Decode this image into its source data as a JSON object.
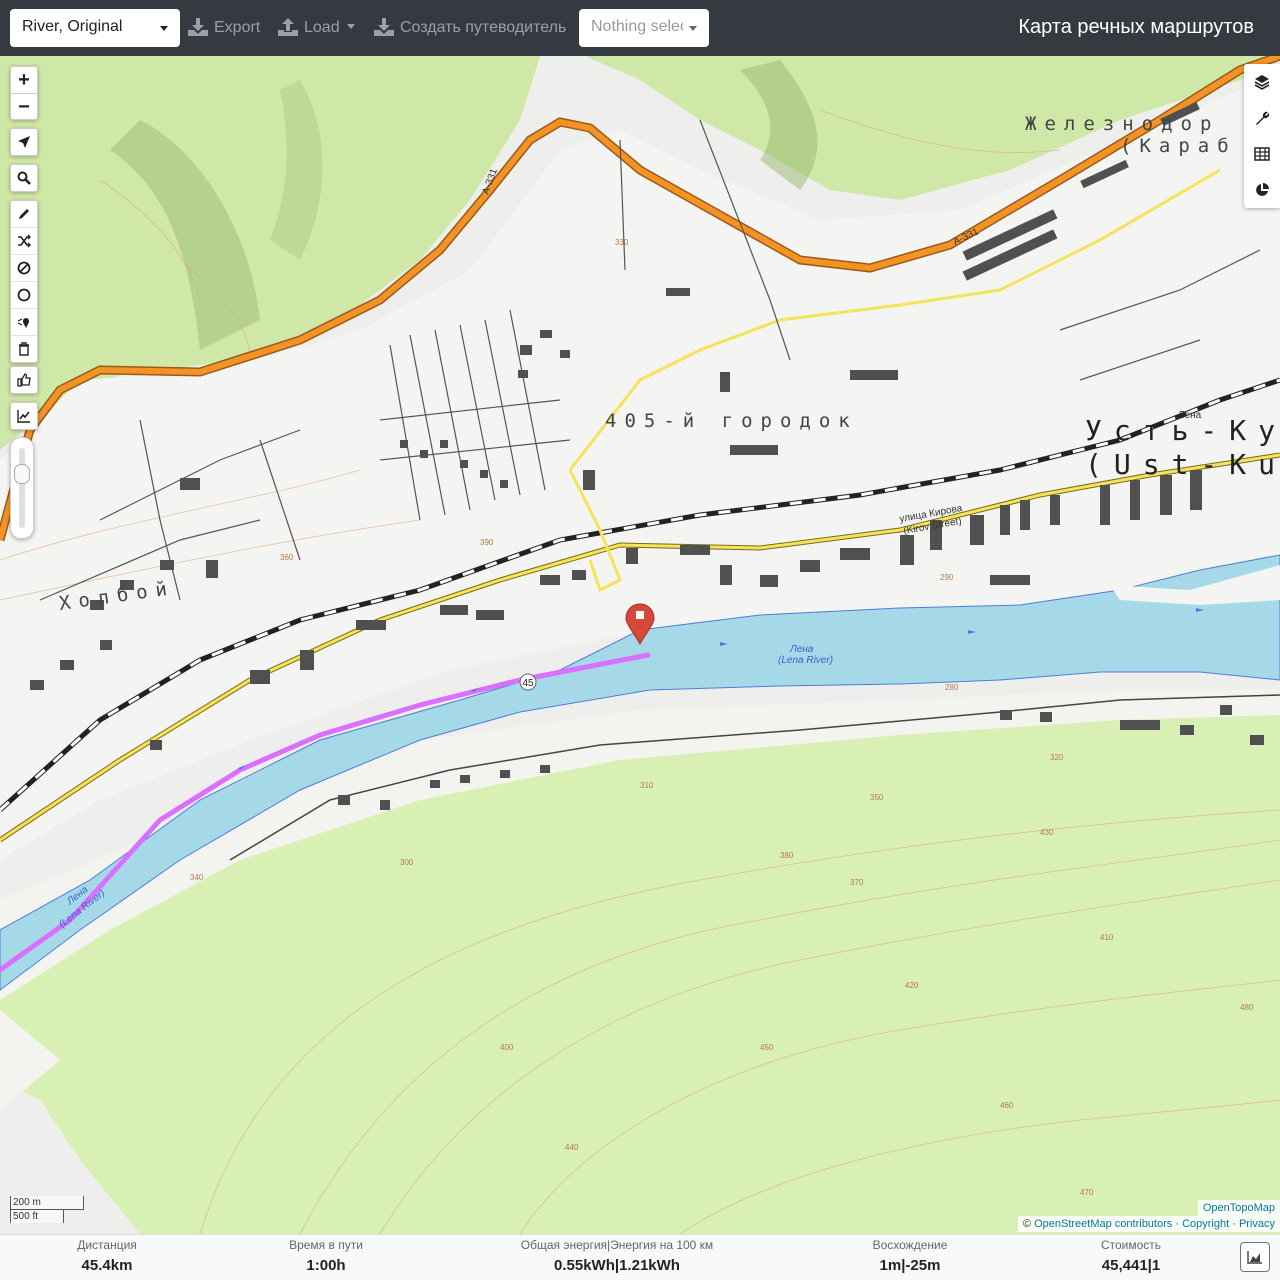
{
  "header": {
    "profile_select": "River, Original",
    "export_label": "Export",
    "load_label": "Load",
    "guide_label": "Создать путеводитель",
    "nothing_selected": "Nothing selected",
    "app_title": "Карта речных маршрутов"
  },
  "map": {
    "labels": {
      "settlement_405": "405-й городок",
      "ust_kut": "Усть-Ку",
      "ust_kut_latin": "(Ust-Ku",
      "zheleznodor": "Железнодор",
      "karab": "(Караб",
      "holboy": "Холбой",
      "lena_river_1": "Лена",
      "lena_river_1_latin": "(Lena River)",
      "lena_river_2": "Лена",
      "lena_river_2_latin": "(Lena River)",
      "kirova_street": "улица Кирова",
      "kirova_street_latin": "(Kirov Street)",
      "road_a331_1": "А-331",
      "road_a331_2": "А-331",
      "lena_small": "Лена",
      "km_marker": "45"
    },
    "contour_labels": [
      "360",
      "380",
      "390",
      "410",
      "420",
      "440",
      "470",
      "280",
      "290",
      "300",
      "310",
      "320",
      "330",
      "340",
      "350",
      "370",
      "400",
      "430",
      "450",
      "460",
      "480"
    ],
    "scale": {
      "metric": "200 m",
      "imperial": "500 ft"
    },
    "layer_name": "OpenTopoMap",
    "attribution": {
      "prefix": "©",
      "osm": "OpenStreetMap contributors",
      "sep1": "·",
      "copyright": "Copyright",
      "sep2": "·",
      "privacy": "Privacy"
    },
    "colors": {
      "water": "#a5d9e8",
      "route": "#da70ff",
      "forest": "#d4eeb0",
      "highway": "#f39325",
      "marker": "#d7483b"
    }
  },
  "stats": {
    "distance": {
      "label": "Дистанция",
      "value": "45.4",
      "unit": "km"
    },
    "time": {
      "label": "Время в пути",
      "value": "1:00",
      "unit": "h"
    },
    "energy": {
      "label": "Общая энергия|Энергия на 100 км",
      "value1": "0.55",
      "unit1": "kWh",
      "sep": "|",
      "value2": "1.21",
      "unit2": "kWh"
    },
    "ascent": {
      "label": "Восхождение",
      "value1": "1",
      "unit1": "m",
      "sep": "|",
      "value2": "-25",
      "unit2": "m"
    },
    "cost": {
      "label": "Стоимость",
      "value": "45,441",
      "sep": "|",
      "value2": "1"
    }
  }
}
